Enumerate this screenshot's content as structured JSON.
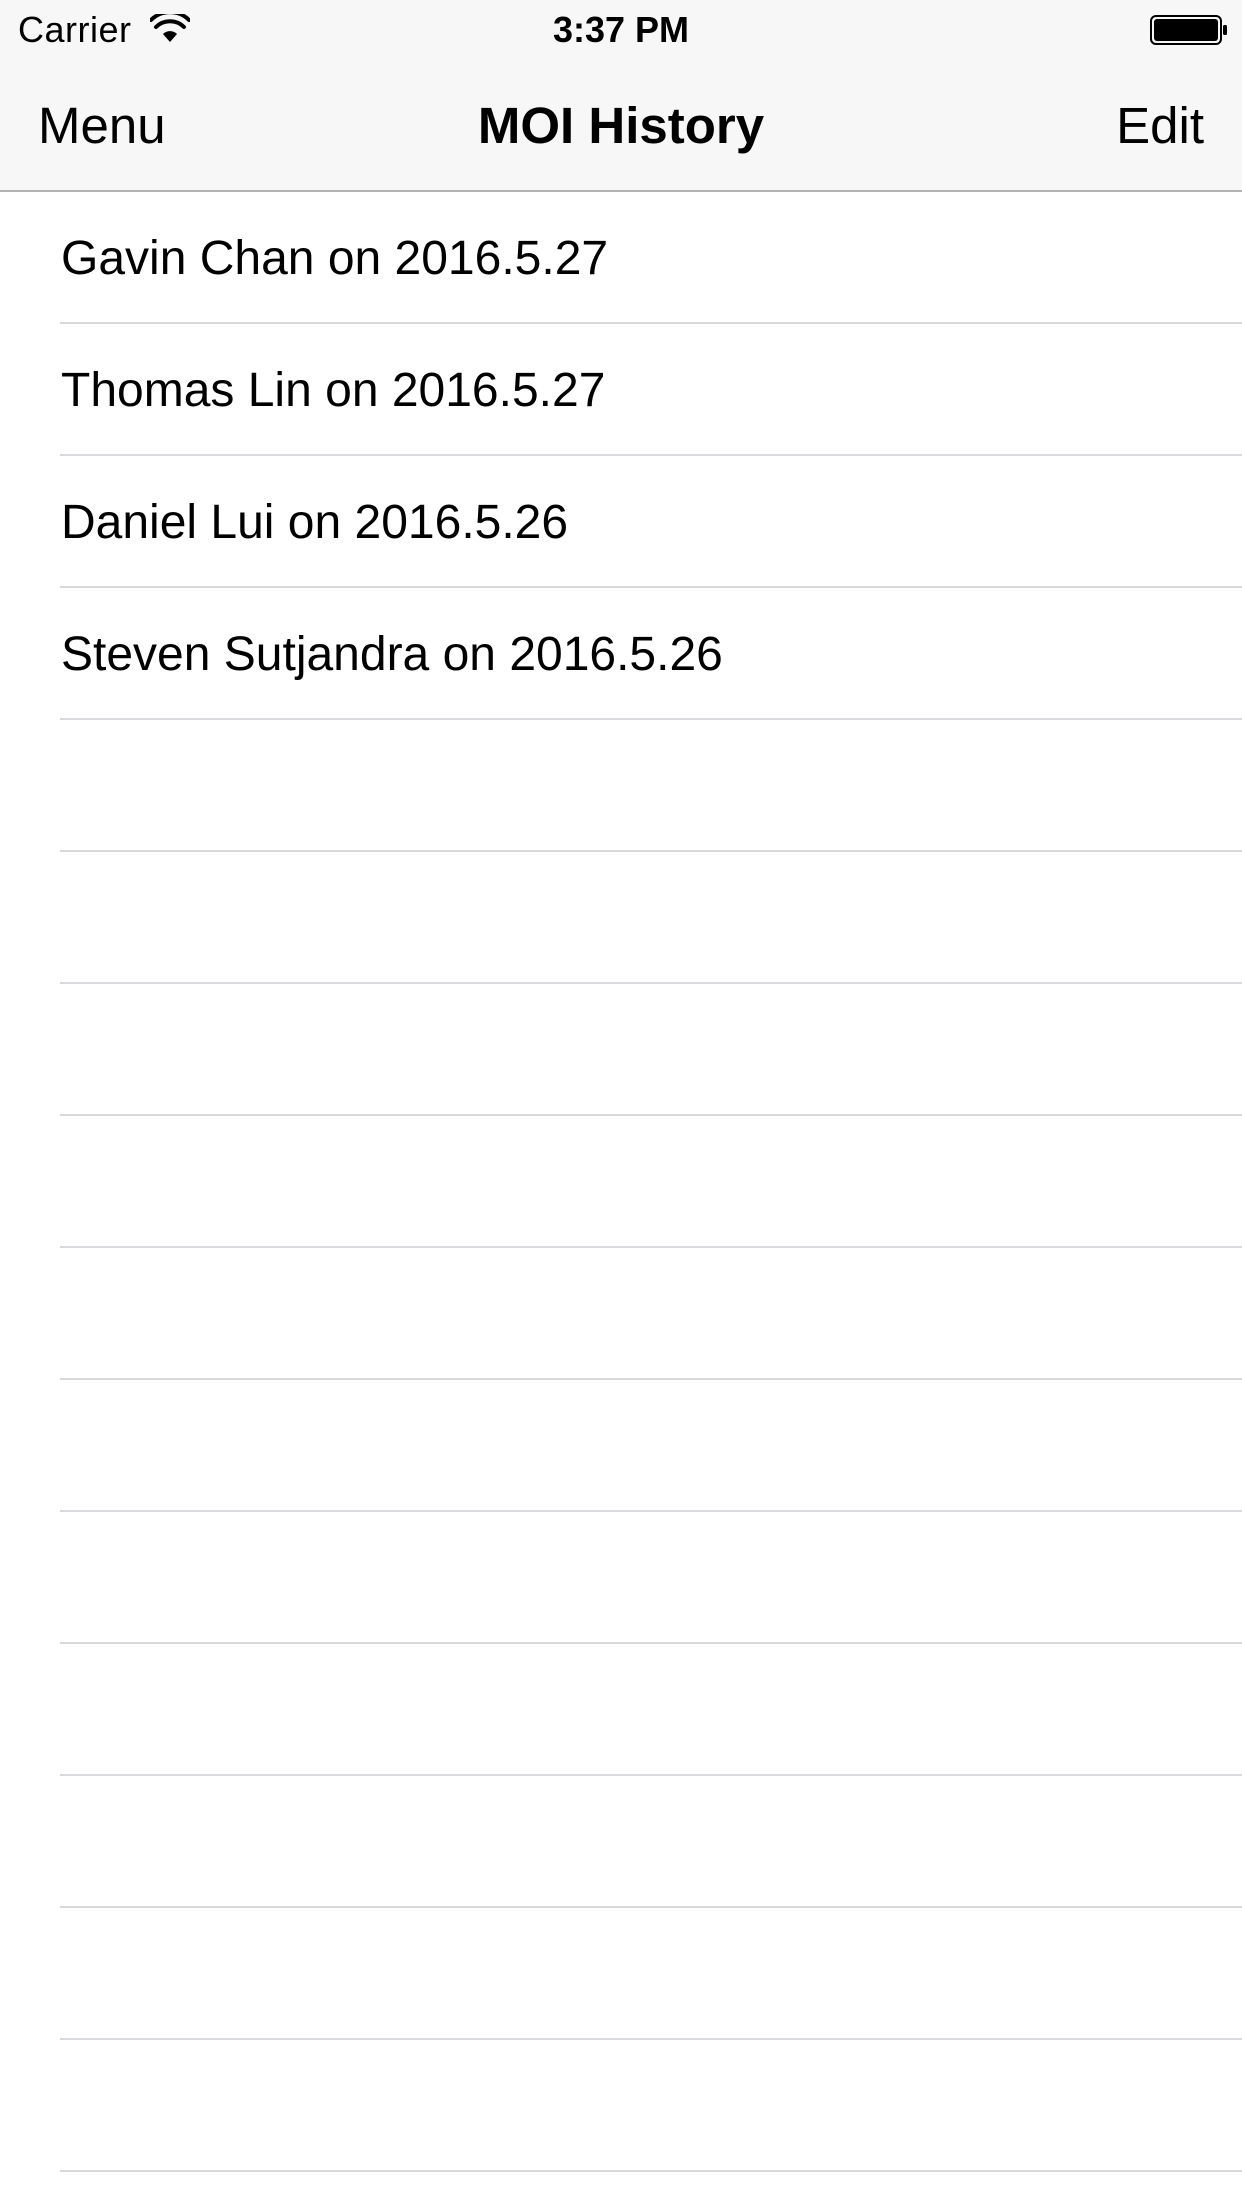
{
  "status_bar": {
    "carrier": "Carrier",
    "time": "3:37 PM",
    "wifi_icon": "wifi-icon",
    "battery_icon": "battery-icon"
  },
  "nav_bar": {
    "left_label": "Menu",
    "title": "MOI History",
    "right_label": "Edit"
  },
  "table": {
    "rows": [
      {
        "label": "Gavin Chan on 2016.5.27"
      },
      {
        "label": "Thomas Lin on 2016.5.27"
      },
      {
        "label": "Daniel Lui on 2016.5.26"
      },
      {
        "label": "Steven Sutjandra on 2016.5.26"
      },
      {
        "label": ""
      },
      {
        "label": ""
      },
      {
        "label": ""
      },
      {
        "label": ""
      },
      {
        "label": ""
      },
      {
        "label": ""
      },
      {
        "label": ""
      },
      {
        "label": ""
      },
      {
        "label": ""
      },
      {
        "label": ""
      },
      {
        "label": ""
      },
      {
        "label": ""
      }
    ]
  },
  "colors": {
    "bar_background": "#f7f7f7",
    "separator": "#d9d9dd",
    "text": "#000000"
  }
}
